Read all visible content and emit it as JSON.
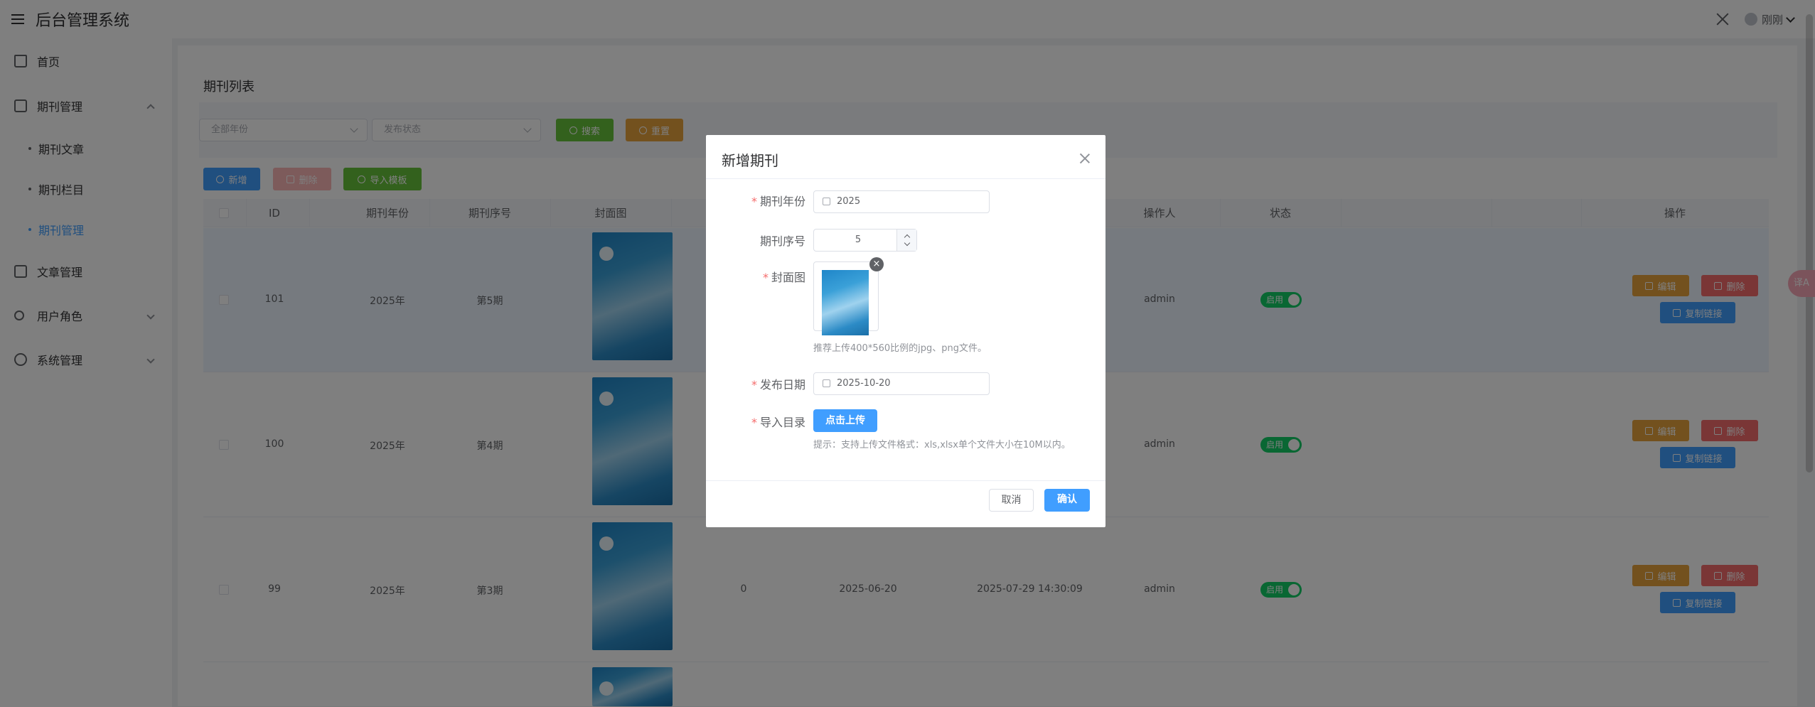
{
  "header": {
    "title": "后台管理系统",
    "user_name": "刚刚"
  },
  "sidebar": {
    "items": [
      {
        "label": "首页"
      },
      {
        "label": "期刊管理"
      },
      {
        "label": "期刊文章"
      },
      {
        "label": "期刊栏目"
      },
      {
        "label": "期刊管理"
      },
      {
        "label": "文章管理"
      },
      {
        "label": "用户角色"
      },
      {
        "label": "系统管理"
      }
    ]
  },
  "page": {
    "title": "期刊列表"
  },
  "filters": {
    "year_placeholder": "全部年份",
    "status_placeholder": "发布状态",
    "search_label": "搜索",
    "reset_label": "重置"
  },
  "toolbar": {
    "add_label": "新增",
    "delete_label": "删除",
    "import_label": "导入模板"
  },
  "table": {
    "headers": {
      "id": "ID",
      "year": "期刊年份",
      "issue": "期刊序号",
      "cover": "封面图",
      "operator": "操作人",
      "status": "状态",
      "actions": "操作"
    },
    "rows": [
      {
        "id": "101",
        "year": "2025年",
        "issue": "第5期",
        "count": "",
        "date": "",
        "created": "",
        "operator": "admin",
        "status": "启用"
      },
      {
        "id": "100",
        "year": "2025年",
        "issue": "第4期",
        "count": "",
        "date": "",
        "created": "",
        "operator": "admin",
        "status": "启用"
      },
      {
        "id": "99",
        "year": "2025年",
        "issue": "第3期",
        "count": "0",
        "date": "2025-06-20",
        "created": "2025-07-29 14:30:09",
        "operator": "admin",
        "status": "启用"
      }
    ],
    "row_actions": {
      "edit": "编辑",
      "delete": "删除",
      "copy_link": "复制链接"
    }
  },
  "dialog": {
    "title": "新增期刊",
    "fields": {
      "year_label": "期刊年份",
      "year_value": "2025",
      "issue_label": "期刊序号",
      "issue_value": "5",
      "cover_label": "封面图",
      "cover_hint": "推荐上传400*560比例的jpg、png文件。",
      "date_label": "发布日期",
      "date_value": "2025-10-20",
      "catalog_label": "导入目录",
      "upload_label": "点击上传",
      "upload_hint": "提示：支持上传文件格式：xls,xlsx单个文件大小在10M以内。"
    },
    "cancel_label": "取消",
    "confirm_label": "确认"
  },
  "translate_badge": "译A",
  "colors": {
    "primary": "#409eff",
    "success": "#67c23a",
    "warning": "#e6a23c",
    "danger": "#f56c6c",
    "switch_on": "#13ce66"
  }
}
